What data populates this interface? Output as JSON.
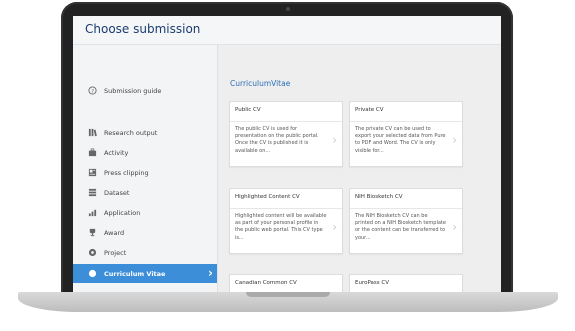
{
  "dialog": {
    "title": "Choose submission"
  },
  "sidebar": {
    "items": [
      {
        "label": "Submission guide",
        "icon": "help-circle-icon",
        "active": false
      },
      {
        "label": "Research output",
        "icon": "books-icon",
        "active": false
      },
      {
        "label": "Activity",
        "icon": "briefcase-icon",
        "active": false
      },
      {
        "label": "Press clipping",
        "icon": "newspaper-icon",
        "active": false
      },
      {
        "label": "Dataset",
        "icon": "database-icon",
        "active": false
      },
      {
        "label": "Application",
        "icon": "bar-chart-icon",
        "active": false
      },
      {
        "label": "Award",
        "icon": "trophy-icon",
        "active": false
      },
      {
        "label": "Project",
        "icon": "project-icon",
        "active": false
      },
      {
        "label": "Curriculum Vitae",
        "icon": "circle-icon",
        "active": true
      }
    ]
  },
  "main": {
    "section_title": "CurriculumVitae",
    "cards": [
      {
        "title": "Public CV",
        "description": "The public CV is used for presentation on the public portal. Once the CV is published it is available on..."
      },
      {
        "title": "Private CV",
        "description": "The private CV can be used to export your selected data from Pure to PDF and Word. The CV is only visible for..."
      },
      {
        "title": "Highlighted Content CV",
        "description": "Highlighted content will be available as part of your personal profile in the public web portal. This CV type is..."
      },
      {
        "title": "NIH Biosketch CV",
        "description": "The NIH Biosketch CV can be printed on a NIH Biosketch template or the content can be transferred to your..."
      },
      {
        "title": "Canadian Common CV",
        "description": ""
      },
      {
        "title": "EuroPass CV",
        "description": ""
      }
    ]
  },
  "colors": {
    "accent": "#3d8ed9",
    "title": "#1b3c6e",
    "link": "#2a6ebb"
  }
}
